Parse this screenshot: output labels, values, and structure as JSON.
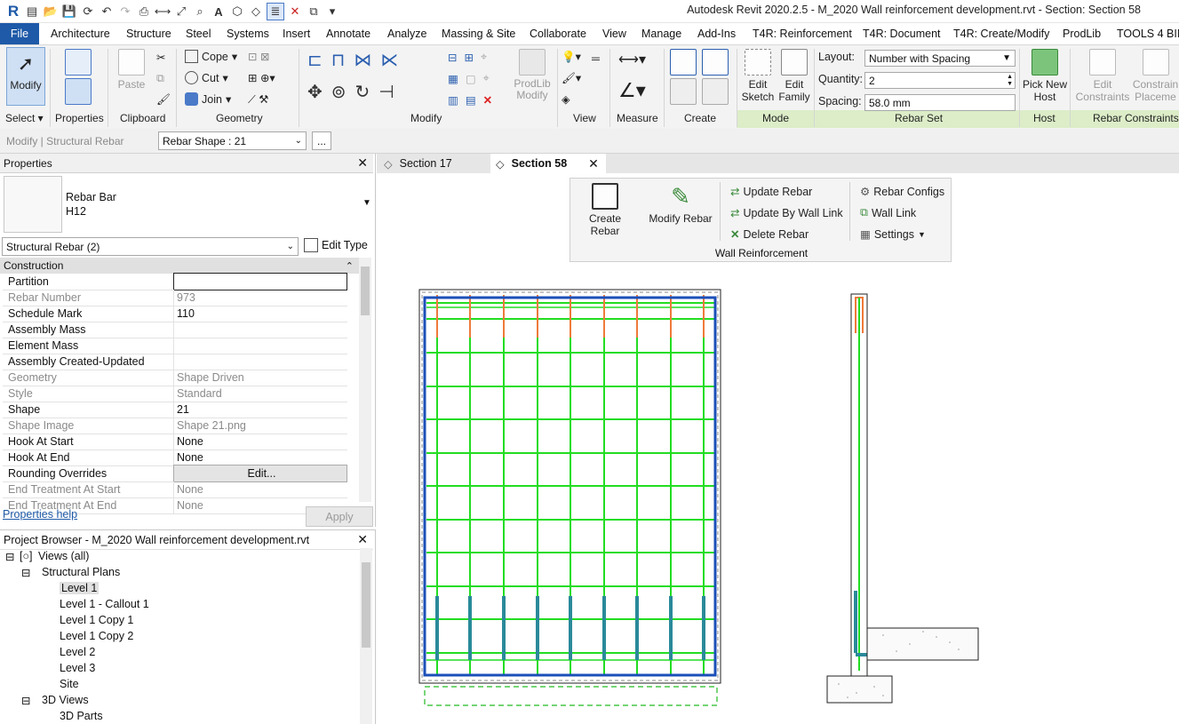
{
  "window": {
    "title": "Autodesk Revit 2020.2.5 - M_2020 Wall reinforcement development.rvt - Section: Section 58"
  },
  "ribbon_tabs": [
    "File",
    "Architecture",
    "Structure",
    "Steel",
    "Systems",
    "Insert",
    "Annotate",
    "Analyze",
    "Massing & Site",
    "Collaborate",
    "View",
    "Manage",
    "Add-Ins",
    "T4R: Reinforcement",
    "T4R: Document",
    "T4R: Create/Modify",
    "ProdLib",
    "TOOLS 4 BIM"
  ],
  "ribbon": {
    "modify": "Modify",
    "select": "Select ▾",
    "properties": "Properties",
    "paste": "Paste",
    "clipboard": "Clipboard",
    "cope": "Cope",
    "cut": "Cut",
    "join": "Join",
    "geometry": "Geometry",
    "prodlib_modify": "ProdLib\nModify",
    "modify_panel": "Modify",
    "view": "View",
    "measure": "Measure",
    "create": "Create",
    "edit_sketch": "Edit\nSketch",
    "edit_family": "Edit\nFamily",
    "mode": "Mode",
    "layout_label": "Layout:",
    "layout_value": "Number with Spacing",
    "quantity_label": "Quantity:",
    "quantity_value": "2",
    "spacing_label": "Spacing:",
    "spacing_value": "58.0 mm",
    "rebar_set": "Rebar Set",
    "pick_new_host": "Pick New\nHost",
    "host": "Host",
    "edit_constraints": "Edit\nConstraints",
    "constrain_placement": "Constrain\nPlaceme",
    "rebar_constraints": "Rebar Constraints"
  },
  "optionsbar": {
    "context": "Modify | Structural Rebar",
    "shape_select": "Rebar Shape : 21",
    "more": "..."
  },
  "properties": {
    "title": "Properties",
    "type_name": "Rebar Bar",
    "type_sub": "H12",
    "filter": "Structural Rebar (2)",
    "edit_type": "Edit Type",
    "group": "Construction",
    "rows": [
      {
        "k": "Partition",
        "v": "",
        "grey": false
      },
      {
        "k": "Rebar Number",
        "v": "973",
        "grey": true
      },
      {
        "k": "Schedule Mark",
        "v": "110",
        "grey": false
      },
      {
        "k": "Assembly Mass",
        "v": "",
        "grey": false
      },
      {
        "k": "Element Mass",
        "v": "",
        "grey": false
      },
      {
        "k": "Assembly Created-Updated",
        "v": "",
        "grey": false
      },
      {
        "k": "Geometry",
        "v": "Shape Driven",
        "grey": true
      },
      {
        "k": "Style",
        "v": "Standard",
        "grey": true
      },
      {
        "k": "Shape",
        "v": "21",
        "grey": false
      },
      {
        "k": "Shape Image",
        "v": "Shape 21.png",
        "grey": true
      },
      {
        "k": "Hook At Start",
        "v": "None",
        "grey": false
      },
      {
        "k": "Hook At End",
        "v": "None",
        "grey": false
      },
      {
        "k": "Rounding Overrides",
        "v": "Edit...",
        "grey": false
      },
      {
        "k": "End Treatment At Start",
        "v": "None",
        "grey": true
      },
      {
        "k": "End Treatment At End",
        "v": "None",
        "grey": true
      }
    ],
    "help": "Properties help",
    "apply": "Apply"
  },
  "browser": {
    "title": "Project Browser - M_2020 Wall reinforcement development.rvt",
    "views_all": "Views (all)",
    "structural_plans": "Structural Plans",
    "plans": [
      "Level 1",
      "Level 1 - Callout 1",
      "Level 1 Copy 1",
      "Level 1 Copy 2",
      "Level 2",
      "Level 3",
      "Site"
    ],
    "views_3d": "3D Views",
    "parts_3d": "3D Parts"
  },
  "view_tabs": [
    "Section 17",
    "Section 58"
  ],
  "wall_reinforcement": {
    "create_rebar": "Create Rebar",
    "modify_rebar": "Modify Rebar",
    "update_rebar": "Update Rebar",
    "update_by_wall_link": "Update By Wall Link",
    "delete_rebar": "Delete Rebar",
    "rebar_configs": "Rebar Configs",
    "wall_link": "Wall Link",
    "settings": "Settings",
    "panel_title": "Wall Reinforcement"
  },
  "colors": {
    "file_tab": "#1e5aa8",
    "rebar_green": "#22dd22",
    "rebar_blue": "#1b4fb8",
    "rebar_orange": "#ef7a3a",
    "rebar_teal": "#2a8a9a"
  }
}
